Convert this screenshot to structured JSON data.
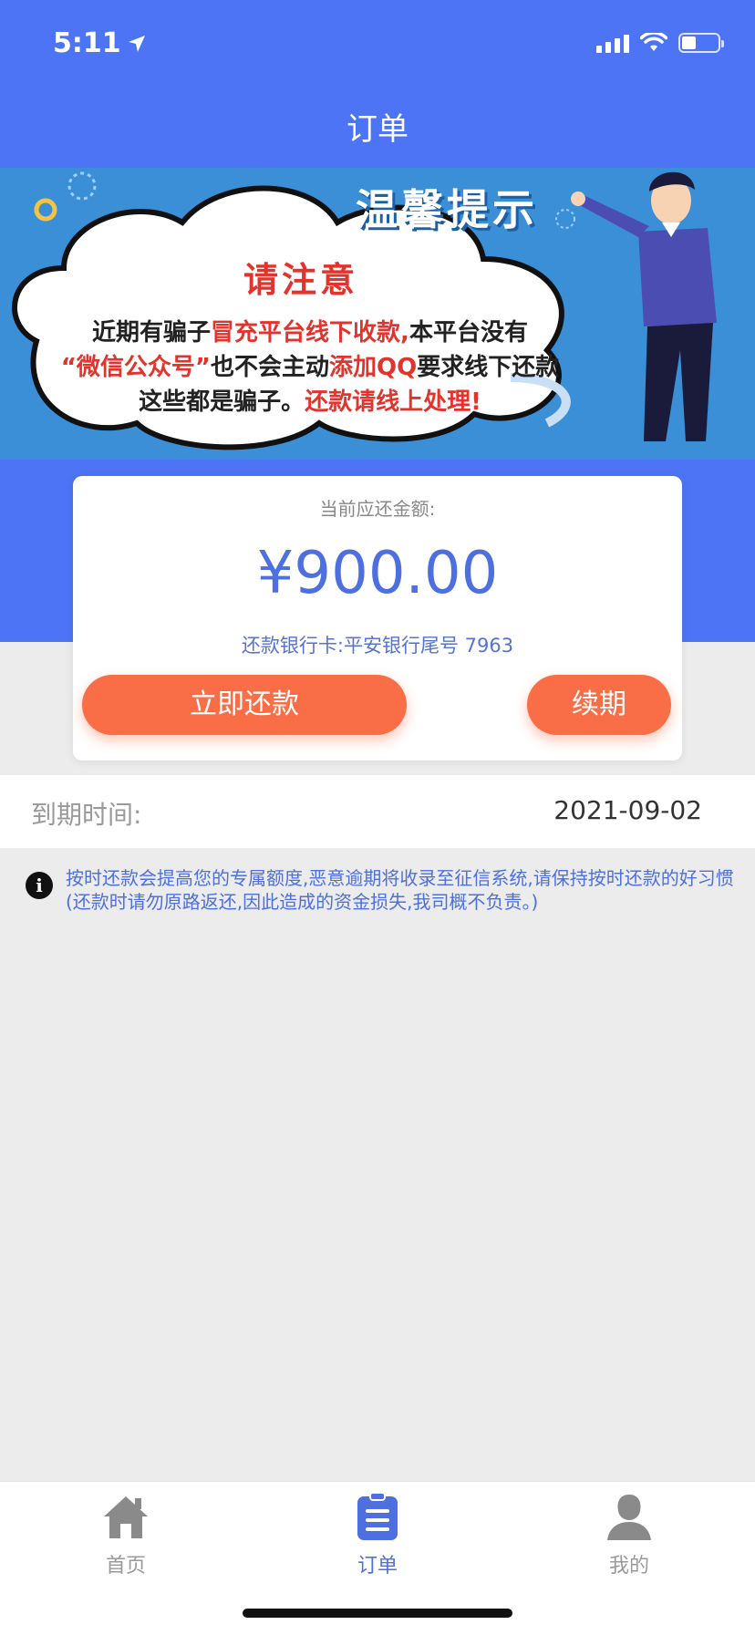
{
  "status_bar": {
    "time": "5:11"
  },
  "header": {
    "title": "订单"
  },
  "banner": {
    "heading": "温馨提示",
    "notice_title": "请注意",
    "line1_a": "近期有骗子",
    "line1_hl": "冒充平台线下收款,",
    "line1_b": "本平台没有",
    "line2_hl1": "“微信公众号”",
    "line2_a": "也不会主动",
    "line2_hl2": "添加QQ",
    "line2_b": "要求线下还款",
    "line3_a": "这些都是骗子。",
    "line3_hl": "还款请线上处理!"
  },
  "card": {
    "label": "当前应还金额:",
    "amount": "¥900.00",
    "bank": "还款银行卡:平安银行尾号 7963",
    "repay_button": "立即还款",
    "renew_button": "续期"
  },
  "due": {
    "label": "到期时间:",
    "value": "2021-09-02"
  },
  "tip": {
    "icon": "info-icon",
    "text": "按时还款会提高您的专属额度,恶意逾期将收录至征信系统,请保持按时还款的好习惯 (还款时请勿原路返还,因此造成的资金损失,我司概不负责。)"
  },
  "tabs": [
    {
      "label": "首页",
      "icon": "home-icon",
      "active": false
    },
    {
      "label": "订单",
      "icon": "clipboard-icon",
      "active": true
    },
    {
      "label": "我的",
      "icon": "user-icon",
      "active": false
    }
  ],
  "colors": {
    "primary": "#4d74f5",
    "accent": "#f96e46",
    "alert": "#e2332d"
  }
}
